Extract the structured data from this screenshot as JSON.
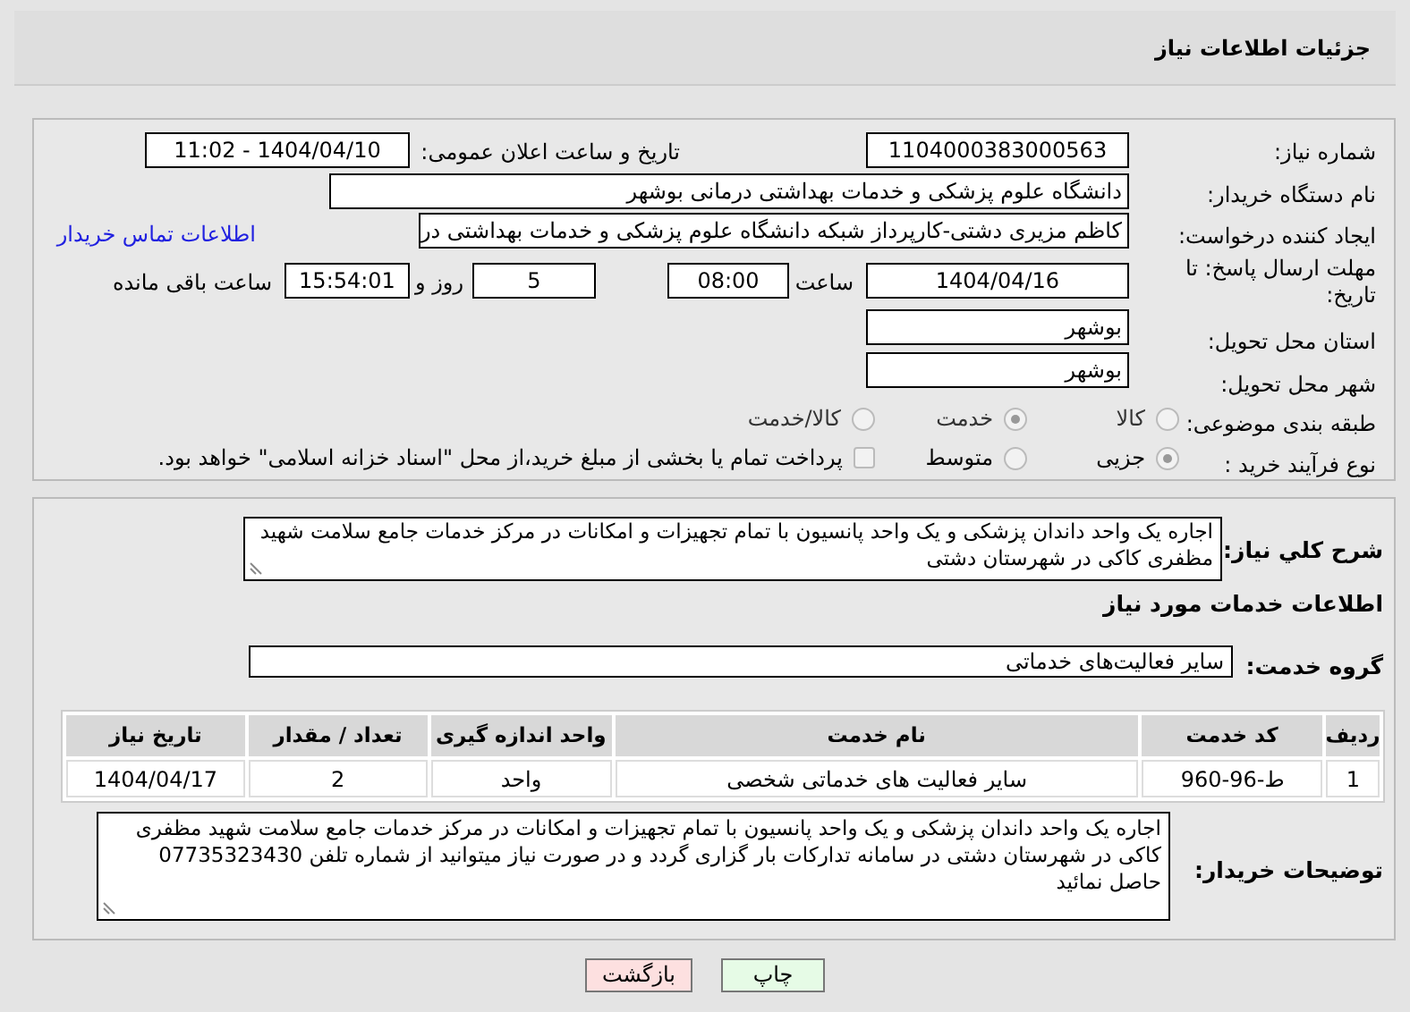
{
  "header": {
    "title": "جزئیات اطلاعات نیاز"
  },
  "details": {
    "need_number": {
      "label": "شماره نیاز:",
      "value": "1104000383000563"
    },
    "announce": {
      "label": "تاریخ و ساعت اعلان عمومی:",
      "value": "1404/04/10 - 11:02"
    },
    "buyer": {
      "label": "نام دستگاه خریدار:",
      "value": "دانشگاه علوم پزشکی و خدمات بهداشتی درمانی بوشهر"
    },
    "requester": {
      "label": "ایجاد کننده درخواست:",
      "value": "کاظم مزیری دشتی-کارپرداز شبکه دانشگاه علوم پزشکی و خدمات بهداشتی در",
      "link": "اطلاعات تماس خریدار"
    },
    "deadline": {
      "label": "مهلت ارسال پاسخ: تا تاریخ:",
      "date": "1404/04/16",
      "time_label": "ساعت",
      "time": "08:00",
      "days": "5",
      "days_label": "روز و",
      "remaining": "15:54:01",
      "remaining_label": "ساعت باقی مانده"
    },
    "province": {
      "label": "استان محل تحویل:",
      "value": "بوشهر"
    },
    "city": {
      "label": "شهر محل تحویل:",
      "value": "بوشهر"
    },
    "category": {
      "label": "طبقه بندی موضوعی:",
      "options": [
        {
          "label": "کالا",
          "selected": false
        },
        {
          "label": "خدمت",
          "selected": true
        },
        {
          "label": "کالا/خدمت",
          "selected": false
        }
      ]
    },
    "process": {
      "label": "نوع فرآیند خرید :",
      "options": [
        {
          "kind": "radio",
          "label": "جزیی",
          "selected": true
        },
        {
          "kind": "radio",
          "label": "متوسط",
          "selected": false
        },
        {
          "kind": "checkbox",
          "label": "پرداخت تمام یا بخشی از مبلغ خرید،از محل \"اسناد خزانه اسلامی\" خواهد بود.",
          "checked": false
        }
      ]
    }
  },
  "services": {
    "description": {
      "label": "شرح کلي نياز:",
      "value": "اجاره یک واحد داندان پزشکی و یک واحد پانسیون با تمام تجهیزات و امکانات در مرکز خدمات جامع سلامت شهید مظفری کاکی در شهرستان دشتی"
    },
    "section_title": "اطلاعات خدمات مورد نیاز",
    "group": {
      "label": "گروه خدمت:",
      "value": "سایر فعالیت‌های خدماتی"
    },
    "table": {
      "columns": [
        "ردیف",
        "کد خدمت",
        "نام خدمت",
        "واحد اندازه گیری",
        "تعداد / مقدار",
        "تاریخ نیاز"
      ],
      "rows": [
        [
          "1",
          "ط-96-960",
          "سایر فعالیت های خدماتی شخصی",
          "واحد",
          "2",
          "1404/04/17"
        ]
      ]
    },
    "notes": {
      "label": "توضیحات خریدار:",
      "value": "اجاره یک واحد داندان پزشکی و یک واحد پانسیون با تمام تجهیزات و امکانات در مرکز خدمات جامع سلامت شهید مظفری کاکی در شهرستان دشتی در سامانه تدارکات بار گزاری گردد و در صورت نیاز میتوانید از شماره تلفن 07735323430 حاصل نمائید"
    }
  },
  "buttons": [
    {
      "kind": "print",
      "label": "چاپ"
    },
    {
      "kind": "back",
      "label": "بازگشت"
    }
  ]
}
